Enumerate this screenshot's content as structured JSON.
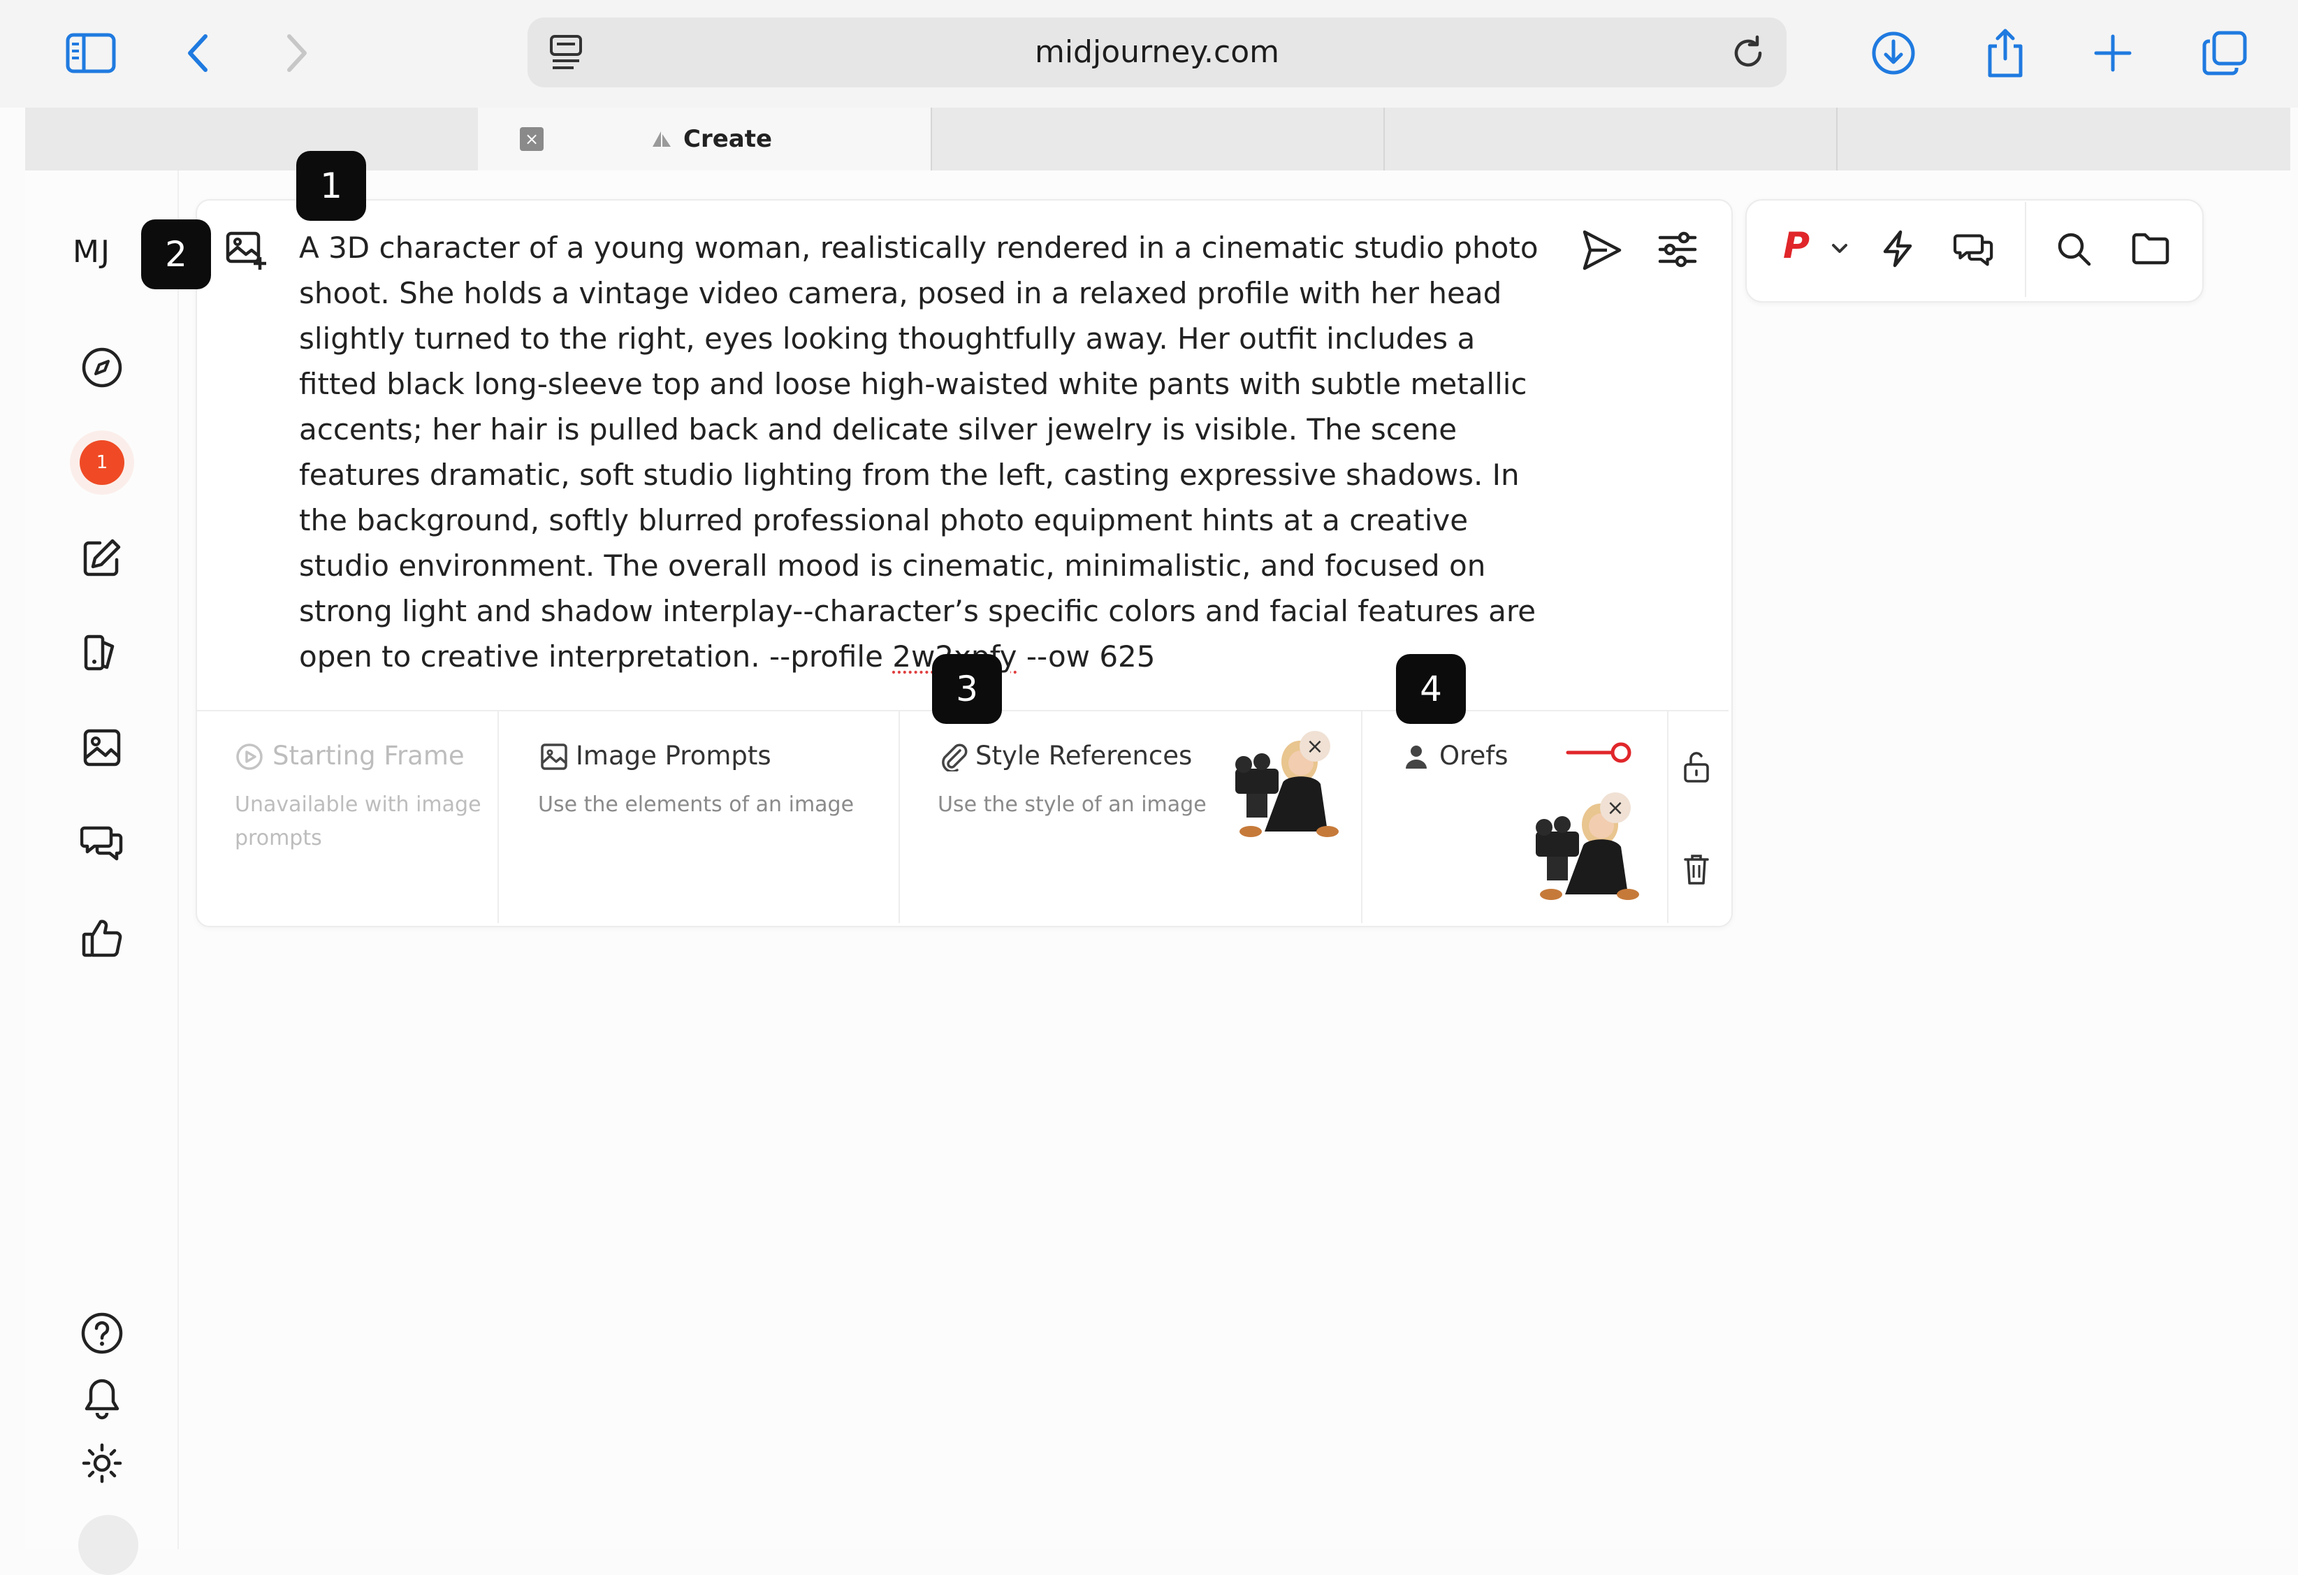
{
  "browser": {
    "url": "midjourney.com",
    "tab_label": "Create"
  },
  "sidebar": {
    "logo": "MJ",
    "notification_count": "1",
    "items": [
      {
        "icon": "compass-icon"
      },
      {
        "icon": "notification-badge"
      },
      {
        "icon": "edit-icon"
      },
      {
        "icon": "organize-icon"
      },
      {
        "icon": "image-icon"
      },
      {
        "icon": "chat-icon"
      },
      {
        "icon": "thumbs-up-icon"
      }
    ],
    "bottom_items": [
      {
        "icon": "help-icon"
      },
      {
        "icon": "bell-icon"
      },
      {
        "icon": "sun-icon"
      }
    ]
  },
  "prompt": {
    "text_main": "A 3D character of a young woman, realistically rendered in a cinematic studio photo shoot. She holds a vintage video camera, posed in a relaxed profile with her head slightly turned to the right, eyes looking thoughtfully away. Her outfit includes a fitted black long-sleeve top and loose high-waisted white pants with subtle metallic accents; her hair is pulled back and delicate silver jewelry is visible. The scene features dramatic, soft studio lighting from the left, casting expressive shadows. In the background, softly blurred professional photo equipment hints at a creative studio environment. The overall mood is cinematic, minimalistic, and focused on strong light and shadow interplay--character’s specific colors and facial features are open to creative interpretation. --profile ",
    "profile_code": "2w2xpfy",
    "text_tail": " --ow 625"
  },
  "sections": {
    "starting_frame": {
      "title": "Starting Frame",
      "subtitle": "Unavailable with image prompts"
    },
    "image_prompts": {
      "title": "Image Prompts",
      "subtitle": "Use the elements of an image"
    },
    "style_references": {
      "title": "Style References",
      "subtitle": "Use the style of an image"
    },
    "orefs": {
      "title": "Orefs"
    }
  },
  "toolbar": {
    "personalize_label": "P"
  },
  "annotations": [
    "1",
    "2",
    "3",
    "4"
  ],
  "colors": {
    "accent_red": "#e0262a",
    "notification": "#ef4a25",
    "browser_blue": "#1f7ae0"
  }
}
